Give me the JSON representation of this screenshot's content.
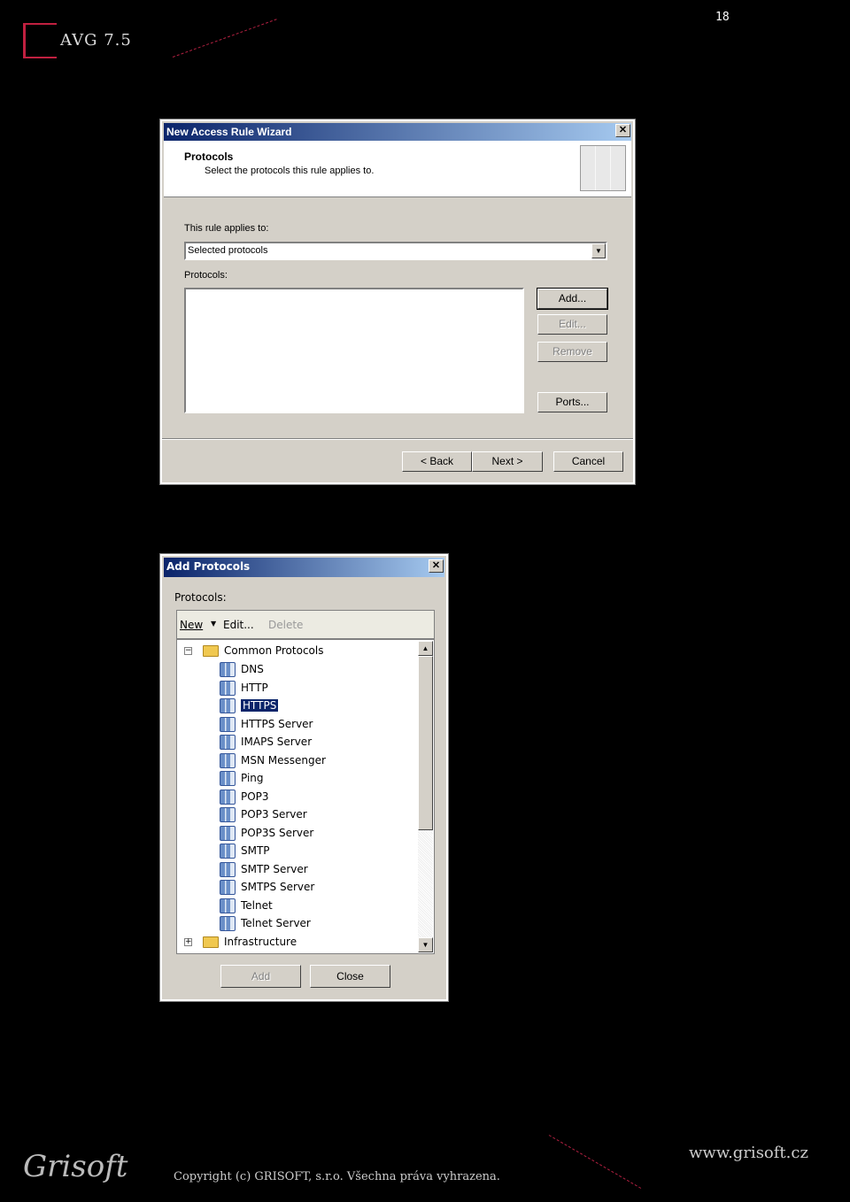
{
  "page": {
    "number": "18",
    "logo_text": "AVG 7.5"
  },
  "wizard": {
    "title": "New Access Rule Wizard",
    "header_title": "Protocols",
    "header_subtitle": "Select the protocols this rule applies to.",
    "applies_label": "This rule applies to:",
    "applies_value": "Selected protocols",
    "protocols_label": "Protocols:",
    "buttons": {
      "add": "Add...",
      "edit": "Edit...",
      "remove": "Remove",
      "ports": "Ports...",
      "back": "< Back",
      "next": "Next >",
      "cancel": "Cancel"
    }
  },
  "add_protocols": {
    "title": "Add Protocols",
    "protocols_label": "Protocols:",
    "toolbar": {
      "new": "New",
      "edit": "Edit...",
      "delete": "Delete"
    },
    "tree": {
      "group": "Common Protocols",
      "items": [
        "DNS",
        "HTTP",
        "HTTPS",
        "HTTPS Server",
        "IMAPS Server",
        "MSN Messenger",
        "Ping",
        "POP3",
        "POP3 Server",
        "POP3S Server",
        "SMTP",
        "SMTP Server",
        "SMTPS Server",
        "Telnet",
        "Telnet Server"
      ],
      "selected": "HTTPS",
      "collapsed_group": "Infrastructure"
    },
    "buttons": {
      "add": "Add",
      "close": "Close"
    }
  },
  "footer": {
    "logo": "Grisoft",
    "copyright": "Copyright (c) GRISOFT, s.r.o. Všechna práva vyhrazena.",
    "url": "www.grisoft.cz"
  }
}
